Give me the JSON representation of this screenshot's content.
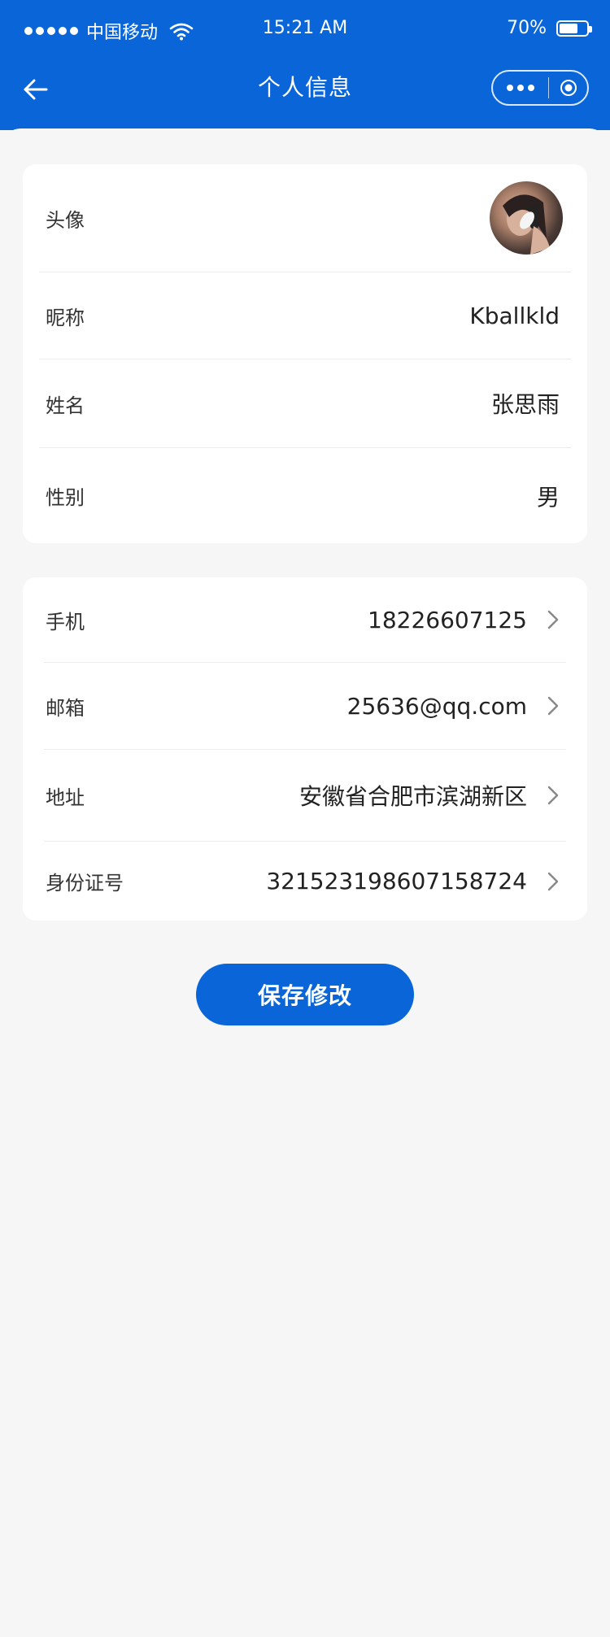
{
  "status_bar": {
    "carrier": "中国移动",
    "time": "15:21 AM",
    "battery_percent": "70%",
    "battery_level": 0.7,
    "signal_icon": "signal-dots-icon",
    "wifi_icon": "wifi-icon",
    "battery_icon": "battery-icon"
  },
  "nav": {
    "title": "个人信息",
    "back_icon": "arrow-left-icon",
    "more_icon": "more-dots-icon",
    "target_icon": "target-circle-icon"
  },
  "profile_card": {
    "avatar_label": "头像",
    "nickname_label": "昵称",
    "nickname_value": "Kballkld",
    "name_label": "姓名",
    "name_value": "张思雨",
    "gender_label": "性别",
    "gender_value": "男"
  },
  "contact_card": {
    "phone_label": "手机",
    "phone_value": "18226607125",
    "email_label": "邮箱",
    "email_value": "25636@qq.com",
    "address_label": "地址",
    "address_value": "安徽省合肥市滨湖新区",
    "id_label": "身份证号",
    "id_value": "321523198607158724",
    "chevron_icon": "chevron-right-icon"
  },
  "actions": {
    "save_label": "保存修改"
  },
  "colors": {
    "primary": "#0a66d8",
    "background": "#f6f6f6",
    "card": "#ffffff"
  }
}
